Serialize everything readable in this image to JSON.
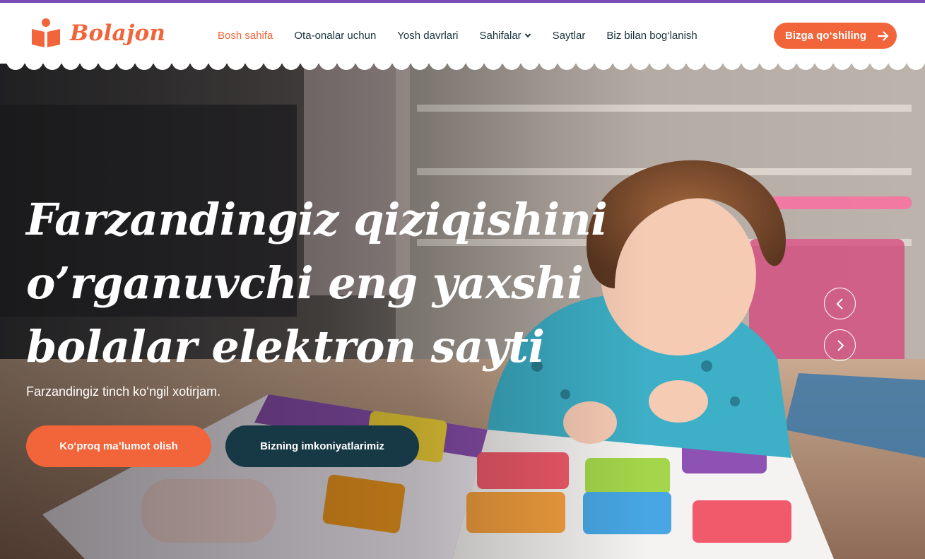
{
  "brand": {
    "name": "Bolajon",
    "accent": "#f2643a",
    "dark": "#173845",
    "top_strip": "#7b4bb5"
  },
  "nav": {
    "items": [
      {
        "label": "Bosh sahifa",
        "active": true
      },
      {
        "label": "Ota-onalar uchun"
      },
      {
        "label": "Yosh davrlari"
      },
      {
        "label": "Sahifalar",
        "dropdown": true
      },
      {
        "label": "Saytlar"
      },
      {
        "label": "Biz bilan bog‘lanish"
      }
    ],
    "cta": "Bizga qo‘shiling"
  },
  "hero": {
    "title_lines": [
      "Farzandingiz qiziqishini",
      "o’rganuvchi eng yaxshi",
      "bolalar elektron sayti"
    ],
    "subtitle": "Farzandingiz tinch ko‘ngil xotirjam.",
    "primary_button": "Ko‘proq ma’lumot olish",
    "secondary_button": "Bizning imkoniyatlarimiz"
  },
  "icons": {
    "logo": "open-book-person-icon",
    "dropdown": "chevron-down-icon",
    "cta": "arrow-right-icon",
    "prev": "chevron-left-icon",
    "next": "chevron-right-icon"
  }
}
